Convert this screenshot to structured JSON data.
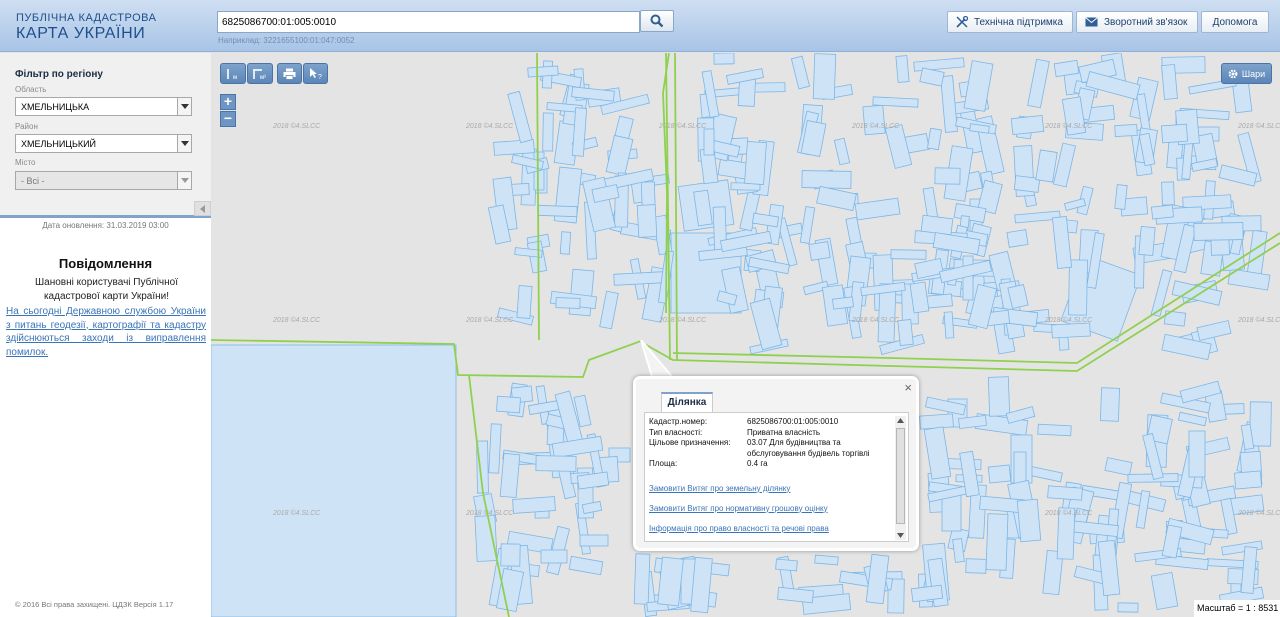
{
  "header": {
    "logo_line1": "ПУБЛІЧНА КАДАСТРОВА",
    "logo_line2": "КАРТА УКРАЇНИ",
    "search_value": "6825086700:01:005:0010",
    "search_hint": "Наприклад: 3221655100:01:047:0052",
    "tech_support": "Технічна підтримка",
    "feedback": "Зворотний зв'язок",
    "help": "Допомога"
  },
  "sidebar": {
    "filter_title": "Фільтр по регіону",
    "oblast_label": "Область",
    "oblast_value": "ХМЕЛЬНИЦЬКА",
    "rayon_label": "Район",
    "rayon_value": "ХМЕЛЬНИЦЬКИЙ",
    "city_label": "Місто",
    "city_value": "- Всі -",
    "update_date": "Дата оновлення: 31.03.2019 03:00",
    "notice_title": "Повідомлення",
    "notice_body": "Шановні користувачі Публічної кадастрової карти України!",
    "notice_link": "На сьогодні Державною службою України з питань геодезії, картографії та кадастру здійснюються заходи із виправлення помилок.",
    "copyright": "© 2016 Всі права захищені. ЦДЗК Версія 1.17"
  },
  "map": {
    "layers_label": "Шари",
    "scale_text": "Масштаб = 1 : 8531",
    "watermark": "2018 ©4.SLCC"
  },
  "popup": {
    "tab_label": "Ділянка",
    "rows": [
      {
        "key": "Кадастр.номер:",
        "value": "6825086700:01:005:0010"
      },
      {
        "key": "Тип власності:",
        "value": "Приватна власність"
      },
      {
        "key": "Цільове призначення:",
        "value": "03.07 Для будівництва та обслуговування будівель торгівлі"
      },
      {
        "key": "Площа:",
        "value": "0.4 га"
      }
    ],
    "link1": "Замовити Витяг про земельну ділянку",
    "link2": "Замовити Витяг про нормативну грошову оцінку",
    "link3": "Інформація про право власності та речові права"
  },
  "colors": {
    "parcel_fill": "#cfe3f6",
    "parcel_stroke": "#7cb6e6",
    "boundary": "#8fd14f"
  }
}
